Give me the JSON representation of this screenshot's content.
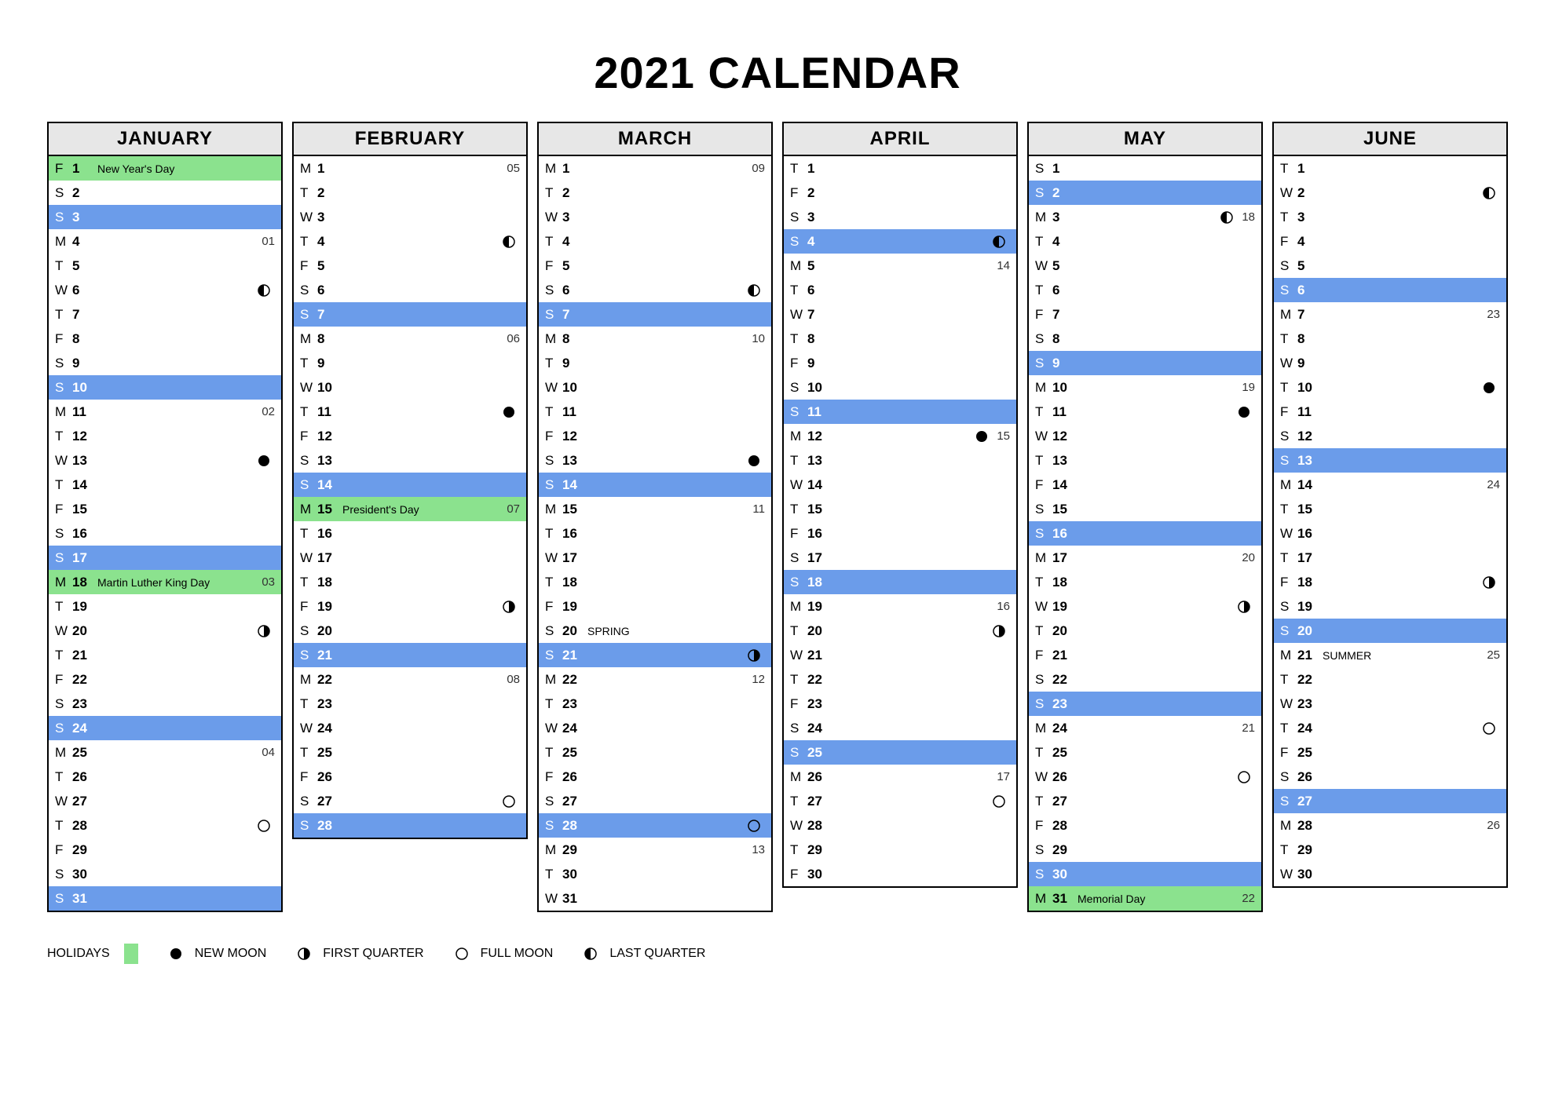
{
  "title": "2021 CALENDAR",
  "legend": {
    "holidays": "HOLIDAYS",
    "new_moon": "NEW MOON",
    "first_quarter": "FIRST QUARTER",
    "full_moon": "FULL MOON",
    "last_quarter": "LAST QUARTER"
  },
  "months": [
    {
      "name": "JANUARY",
      "days": [
        {
          "dow": "F",
          "num": 1,
          "label": "New Year's Day",
          "holiday": true
        },
        {
          "dow": "S",
          "num": 2
        },
        {
          "dow": "S",
          "num": 3,
          "sunday": true
        },
        {
          "dow": "M",
          "num": 4,
          "week": "01"
        },
        {
          "dow": "T",
          "num": 5
        },
        {
          "dow": "W",
          "num": 6,
          "moon": "last"
        },
        {
          "dow": "T",
          "num": 7
        },
        {
          "dow": "F",
          "num": 8
        },
        {
          "dow": "S",
          "num": 9
        },
        {
          "dow": "S",
          "num": 10,
          "sunday": true
        },
        {
          "dow": "M",
          "num": 11,
          "week": "02"
        },
        {
          "dow": "T",
          "num": 12
        },
        {
          "dow": "W",
          "num": 13,
          "moon": "new"
        },
        {
          "dow": "T",
          "num": 14
        },
        {
          "dow": "F",
          "num": 15
        },
        {
          "dow": "S",
          "num": 16
        },
        {
          "dow": "S",
          "num": 17,
          "sunday": true
        },
        {
          "dow": "M",
          "num": 18,
          "label": "Martin Luther King Day",
          "holiday": true,
          "week": "03"
        },
        {
          "dow": "T",
          "num": 19
        },
        {
          "dow": "W",
          "num": 20,
          "moon": "first"
        },
        {
          "dow": "T",
          "num": 21
        },
        {
          "dow": "F",
          "num": 22
        },
        {
          "dow": "S",
          "num": 23
        },
        {
          "dow": "S",
          "num": 24,
          "sunday": true
        },
        {
          "dow": "M",
          "num": 25,
          "week": "04"
        },
        {
          "dow": "T",
          "num": 26
        },
        {
          "dow": "W",
          "num": 27
        },
        {
          "dow": "T",
          "num": 28,
          "moon": "full"
        },
        {
          "dow": "F",
          "num": 29
        },
        {
          "dow": "S",
          "num": 30
        },
        {
          "dow": "S",
          "num": 31,
          "sunday": true
        }
      ]
    },
    {
      "name": "FEBRUARY",
      "days": [
        {
          "dow": "M",
          "num": 1,
          "week": "05"
        },
        {
          "dow": "T",
          "num": 2
        },
        {
          "dow": "W",
          "num": 3
        },
        {
          "dow": "T",
          "num": 4,
          "moon": "last"
        },
        {
          "dow": "F",
          "num": 5
        },
        {
          "dow": "S",
          "num": 6
        },
        {
          "dow": "S",
          "num": 7,
          "sunday": true
        },
        {
          "dow": "M",
          "num": 8,
          "week": "06"
        },
        {
          "dow": "T",
          "num": 9
        },
        {
          "dow": "W",
          "num": 10
        },
        {
          "dow": "T",
          "num": 11,
          "moon": "new"
        },
        {
          "dow": "F",
          "num": 12
        },
        {
          "dow": "S",
          "num": 13
        },
        {
          "dow": "S",
          "num": 14,
          "sunday": true
        },
        {
          "dow": "M",
          "num": 15,
          "label": "President's Day",
          "holiday": true,
          "week": "07"
        },
        {
          "dow": "T",
          "num": 16
        },
        {
          "dow": "W",
          "num": 17
        },
        {
          "dow": "T",
          "num": 18
        },
        {
          "dow": "F",
          "num": 19,
          "moon": "first"
        },
        {
          "dow": "S",
          "num": 20
        },
        {
          "dow": "S",
          "num": 21,
          "sunday": true
        },
        {
          "dow": "M",
          "num": 22,
          "week": "08"
        },
        {
          "dow": "T",
          "num": 23
        },
        {
          "dow": "W",
          "num": 24
        },
        {
          "dow": "T",
          "num": 25
        },
        {
          "dow": "F",
          "num": 26
        },
        {
          "dow": "S",
          "num": 27,
          "moon": "full"
        },
        {
          "dow": "S",
          "num": 28,
          "sunday": true
        }
      ]
    },
    {
      "name": "MARCH",
      "days": [
        {
          "dow": "M",
          "num": 1,
          "week": "09"
        },
        {
          "dow": "T",
          "num": 2
        },
        {
          "dow": "W",
          "num": 3
        },
        {
          "dow": "T",
          "num": 4
        },
        {
          "dow": "F",
          "num": 5
        },
        {
          "dow": "S",
          "num": 6,
          "moon": "last"
        },
        {
          "dow": "S",
          "num": 7,
          "sunday": true
        },
        {
          "dow": "M",
          "num": 8,
          "week": "10"
        },
        {
          "dow": "T",
          "num": 9
        },
        {
          "dow": "W",
          "num": 10
        },
        {
          "dow": "T",
          "num": 11
        },
        {
          "dow": "F",
          "num": 12
        },
        {
          "dow": "S",
          "num": 13,
          "moon": "new"
        },
        {
          "dow": "S",
          "num": 14,
          "sunday": true
        },
        {
          "dow": "M",
          "num": 15,
          "week": "11"
        },
        {
          "dow": "T",
          "num": 16
        },
        {
          "dow": "W",
          "num": 17
        },
        {
          "dow": "T",
          "num": 18
        },
        {
          "dow": "F",
          "num": 19
        },
        {
          "dow": "S",
          "num": 20,
          "label": "SPRING"
        },
        {
          "dow": "S",
          "num": 21,
          "sunday": true,
          "moon": "first"
        },
        {
          "dow": "M",
          "num": 22,
          "week": "12"
        },
        {
          "dow": "T",
          "num": 23
        },
        {
          "dow": "W",
          "num": 24
        },
        {
          "dow": "T",
          "num": 25
        },
        {
          "dow": "F",
          "num": 26
        },
        {
          "dow": "S",
          "num": 27
        },
        {
          "dow": "S",
          "num": 28,
          "sunday": true,
          "moon": "full"
        },
        {
          "dow": "M",
          "num": 29,
          "week": "13"
        },
        {
          "dow": "T",
          "num": 30
        },
        {
          "dow": "W",
          "num": 31
        }
      ]
    },
    {
      "name": "APRIL",
      "days": [
        {
          "dow": "T",
          "num": 1
        },
        {
          "dow": "F",
          "num": 2
        },
        {
          "dow": "S",
          "num": 3
        },
        {
          "dow": "S",
          "num": 4,
          "sunday": true,
          "moon": "last"
        },
        {
          "dow": "M",
          "num": 5,
          "week": "14"
        },
        {
          "dow": "T",
          "num": 6
        },
        {
          "dow": "W",
          "num": 7
        },
        {
          "dow": "T",
          "num": 8
        },
        {
          "dow": "F",
          "num": 9
        },
        {
          "dow": "S",
          "num": 10
        },
        {
          "dow": "S",
          "num": 11,
          "sunday": true
        },
        {
          "dow": "M",
          "num": 12,
          "moon": "new",
          "week": "15"
        },
        {
          "dow": "T",
          "num": 13
        },
        {
          "dow": "W",
          "num": 14
        },
        {
          "dow": "T",
          "num": 15
        },
        {
          "dow": "F",
          "num": 16
        },
        {
          "dow": "S",
          "num": 17
        },
        {
          "dow": "S",
          "num": 18,
          "sunday": true
        },
        {
          "dow": "M",
          "num": 19,
          "week": "16"
        },
        {
          "dow": "T",
          "num": 20,
          "moon": "first"
        },
        {
          "dow": "W",
          "num": 21
        },
        {
          "dow": "T",
          "num": 22
        },
        {
          "dow": "F",
          "num": 23
        },
        {
          "dow": "S",
          "num": 24
        },
        {
          "dow": "S",
          "num": 25,
          "sunday": true
        },
        {
          "dow": "M",
          "num": 26,
          "week": "17"
        },
        {
          "dow": "T",
          "num": 27,
          "moon": "full"
        },
        {
          "dow": "W",
          "num": 28
        },
        {
          "dow": "T",
          "num": 29
        },
        {
          "dow": "F",
          "num": 30
        }
      ]
    },
    {
      "name": "MAY",
      "days": [
        {
          "dow": "S",
          "num": 1
        },
        {
          "dow": "S",
          "num": 2,
          "sunday": true
        },
        {
          "dow": "M",
          "num": 3,
          "moon": "last",
          "week": "18"
        },
        {
          "dow": "T",
          "num": 4
        },
        {
          "dow": "W",
          "num": 5
        },
        {
          "dow": "T",
          "num": 6
        },
        {
          "dow": "F",
          "num": 7
        },
        {
          "dow": "S",
          "num": 8
        },
        {
          "dow": "S",
          "num": 9,
          "sunday": true
        },
        {
          "dow": "M",
          "num": 10,
          "week": "19"
        },
        {
          "dow": "T",
          "num": 11,
          "moon": "new"
        },
        {
          "dow": "W",
          "num": 12
        },
        {
          "dow": "T",
          "num": 13
        },
        {
          "dow": "F",
          "num": 14
        },
        {
          "dow": "S",
          "num": 15
        },
        {
          "dow": "S",
          "num": 16,
          "sunday": true
        },
        {
          "dow": "M",
          "num": 17,
          "week": "20"
        },
        {
          "dow": "T",
          "num": 18
        },
        {
          "dow": "W",
          "num": 19,
          "moon": "first"
        },
        {
          "dow": "T",
          "num": 20
        },
        {
          "dow": "F",
          "num": 21
        },
        {
          "dow": "S",
          "num": 22
        },
        {
          "dow": "S",
          "num": 23,
          "sunday": true
        },
        {
          "dow": "M",
          "num": 24,
          "week": "21"
        },
        {
          "dow": "T",
          "num": 25
        },
        {
          "dow": "W",
          "num": 26,
          "moon": "full"
        },
        {
          "dow": "T",
          "num": 27
        },
        {
          "dow": "F",
          "num": 28
        },
        {
          "dow": "S",
          "num": 29
        },
        {
          "dow": "S",
          "num": 30,
          "sunday": true
        },
        {
          "dow": "M",
          "num": 31,
          "label": "Memorial Day",
          "holiday": true,
          "week": "22"
        }
      ]
    },
    {
      "name": "JUNE",
      "days": [
        {
          "dow": "T",
          "num": 1
        },
        {
          "dow": "W",
          "num": 2,
          "moon": "last"
        },
        {
          "dow": "T",
          "num": 3
        },
        {
          "dow": "F",
          "num": 4
        },
        {
          "dow": "S",
          "num": 5
        },
        {
          "dow": "S",
          "num": 6,
          "sunday": true
        },
        {
          "dow": "M",
          "num": 7,
          "week": "23"
        },
        {
          "dow": "T",
          "num": 8
        },
        {
          "dow": "W",
          "num": 9
        },
        {
          "dow": "T",
          "num": 10,
          "moon": "new"
        },
        {
          "dow": "F",
          "num": 11
        },
        {
          "dow": "S",
          "num": 12
        },
        {
          "dow": "S",
          "num": 13,
          "sunday": true
        },
        {
          "dow": "M",
          "num": 14,
          "week": "24"
        },
        {
          "dow": "T",
          "num": 15
        },
        {
          "dow": "W",
          "num": 16
        },
        {
          "dow": "T",
          "num": 17
        },
        {
          "dow": "F",
          "num": 18,
          "moon": "first"
        },
        {
          "dow": "S",
          "num": 19
        },
        {
          "dow": "S",
          "num": 20,
          "sunday": true
        },
        {
          "dow": "M",
          "num": 21,
          "label": "SUMMER",
          "week": "25"
        },
        {
          "dow": "T",
          "num": 22
        },
        {
          "dow": "W",
          "num": 23
        },
        {
          "dow": "T",
          "num": 24,
          "moon": "full"
        },
        {
          "dow": "F",
          "num": 25
        },
        {
          "dow": "S",
          "num": 26
        },
        {
          "dow": "S",
          "num": 27,
          "sunday": true
        },
        {
          "dow": "M",
          "num": 28,
          "week": "26"
        },
        {
          "dow": "T",
          "num": 29
        },
        {
          "dow": "W",
          "num": 30
        }
      ]
    }
  ]
}
